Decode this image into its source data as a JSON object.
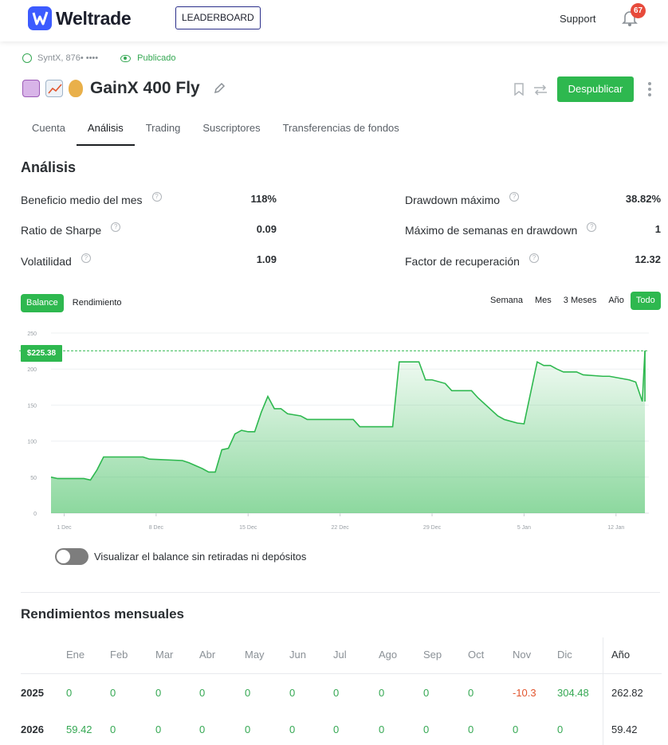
{
  "header": {
    "brand": "Weltrade",
    "leaderboard": "LEADERBOARD",
    "support": "Support",
    "notifications": "67"
  },
  "meta": {
    "account": "SyntX, 876• ••••",
    "status": "Publicado"
  },
  "strategy": {
    "name": "GainX 400 Fly",
    "unpublish": "Despublicar"
  },
  "tabs": [
    "Cuenta",
    "Análisis",
    "Trading",
    "Suscriptores",
    "Transferencias de fondos"
  ],
  "analysis": {
    "title": "Análisis",
    "metrics": [
      {
        "label": "Beneficio medio del mes",
        "value": "118%"
      },
      {
        "label": "Ratio de Sharpe",
        "value": "0.09"
      },
      {
        "label": "Volatilidad",
        "value": "1.09"
      },
      {
        "label": "Drawdown máximo",
        "value": "38.82%"
      },
      {
        "label": "Máximo de semanas en drawdown",
        "value": "1"
      },
      {
        "label": "Factor de recuperación",
        "value": "12.32"
      }
    ]
  },
  "chart_controls": {
    "left": [
      "Balance",
      "Rendimiento"
    ],
    "right": [
      "Semana",
      "Mes",
      "3 Meses",
      "Año",
      "Todo"
    ],
    "current_value": "$225.38"
  },
  "chart_data": {
    "type": "area",
    "y_ticks": [
      "0",
      "50",
      "100",
      "150",
      "200",
      "250"
    ],
    "x_ticks": [
      "1 Dec",
      "8 Dec",
      "15 Dec",
      "22 Dec",
      "29 Dec",
      "5 Jan",
      "12 Jan"
    ],
    "ylim": [
      0,
      250
    ],
    "grid": true,
    "series": [
      {
        "x": [
          0.0,
          0.5,
          2.5,
          3.0,
          3.5,
          4.0,
          7.0,
          7.5,
          10.0,
          10.5,
          11.0,
          11.5,
          12.0,
          12.5,
          13.0,
          13.5,
          14.0,
          14.5,
          15.0,
          15.5,
          16.0,
          16.5,
          17.0,
          17.5,
          18.0,
          19.0,
          19.5,
          20.0,
          23.0,
          23.5,
          26.0,
          26.5,
          27.5,
          28.0,
          28.5,
          29.0,
          30.0,
          30.5,
          32.0,
          32.5,
          34.0,
          34.5,
          35.5,
          36.0,
          37.0,
          37.5,
          38.0,
          38.5,
          39.0,
          40.0,
          40.5,
          42.0,
          42.5,
          44.0,
          44.5,
          45.0,
          45.2
        ],
        "values": [
          50,
          48,
          48,
          46,
          60,
          78,
          78,
          75,
          73,
          70,
          66,
          62,
          57,
          57,
          88,
          90,
          110,
          115,
          113,
          113,
          140,
          162,
          145,
          145,
          138,
          135,
          130,
          130,
          130,
          120,
          120,
          210,
          210,
          210,
          185,
          185,
          180,
          170,
          170,
          160,
          135,
          130,
          125,
          124,
          210,
          205,
          205,
          200,
          196,
          196,
          192,
          190,
          190,
          185,
          182,
          155,
          225.38
        ],
        "color": "#2eb84f"
      }
    ]
  },
  "toggle_label": "Visualizar el balance sin retiradas ni depósitos",
  "monthly": {
    "title": "Rendimientos mensuales",
    "months": [
      "Ene",
      "Feb",
      "Mar",
      "Abr",
      "May",
      "Jun",
      "Jul",
      "Ago",
      "Sep",
      "Oct",
      "Nov",
      "Dic"
    ],
    "year_header": "Año",
    "rows": [
      {
        "year": "2025",
        "values": [
          "0",
          "0",
          "0",
          "0",
          "0",
          "0",
          "0",
          "0",
          "0",
          "0",
          "-10.3",
          "304.48"
        ],
        "total": "262.82"
      },
      {
        "year": "2026",
        "values": [
          "59.42",
          "0",
          "0",
          "0",
          "0",
          "0",
          "0",
          "0",
          "0",
          "0",
          "0",
          "0"
        ],
        "total": "59.42"
      }
    ]
  }
}
